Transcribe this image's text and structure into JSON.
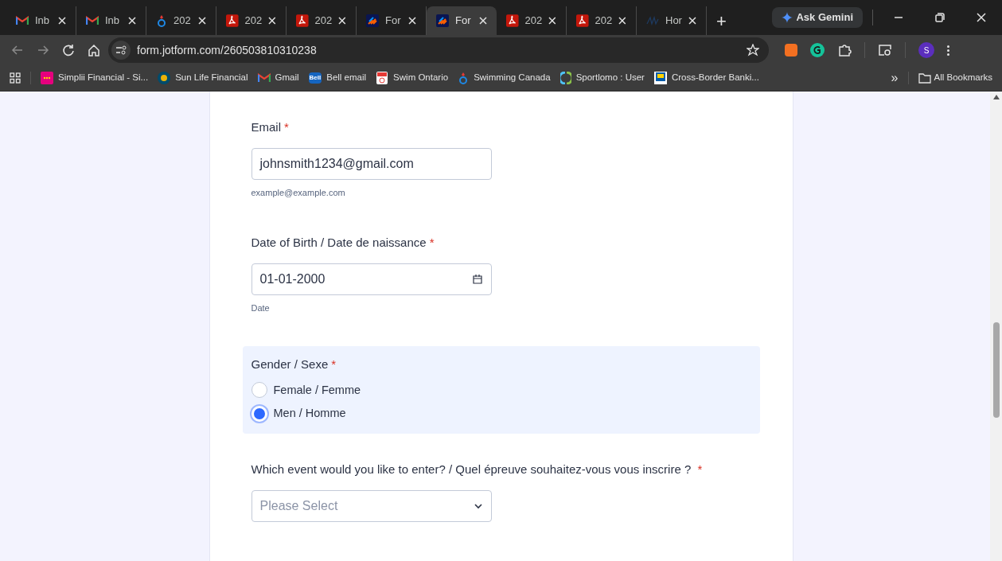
{
  "tabs": [
    {
      "kind": "gmail",
      "label": "Inb",
      "selected": false
    },
    {
      "kind": "gmail",
      "label": "Inb",
      "selected": false
    },
    {
      "kind": "swim",
      "label": "202",
      "selected": false
    },
    {
      "kind": "pdf",
      "label": "202",
      "selected": false
    },
    {
      "kind": "pdf",
      "label": "202",
      "selected": false
    },
    {
      "kind": "jotform",
      "label": "For",
      "selected": false
    },
    {
      "kind": "jotform",
      "label": "For",
      "selected": true
    },
    {
      "kind": "pdf",
      "label": "202",
      "selected": false
    },
    {
      "kind": "pdf",
      "label": "202",
      "selected": false
    },
    {
      "kind": "pen",
      "label": "Hor",
      "selected": false
    }
  ],
  "new_tab": "+",
  "gemini": "Ask Gemini",
  "address": "form.jotform.com/260503810310238",
  "profile": "S",
  "bookmarks": [
    {
      "kind": "simplii",
      "label": "Simplii Financial - Si..."
    },
    {
      "kind": "sunlife",
      "label": "Sun Life Financial"
    },
    {
      "kind": "gmail",
      "label": "Gmail"
    },
    {
      "kind": "bell",
      "label": "Bell email",
      "icon_text": "Bell"
    },
    {
      "kind": "swimon",
      "label": "Swim Ontario"
    },
    {
      "kind": "swim",
      "label": "Swimming Canada"
    },
    {
      "kind": "sportlomo",
      "label": "Sportlomo : User"
    },
    {
      "kind": "rbc",
      "label": "Cross-Border Banki..."
    }
  ],
  "overflow": "»",
  "all_bookmarks": "All Bookmarks",
  "form": {
    "email": {
      "label": "Email",
      "required_mark": "*",
      "value": "johnsmith1234@gmail.com",
      "hint": "example@example.com"
    },
    "dob": {
      "label": "Date of Birth / Date de naissance",
      "required_mark": "*",
      "value": "01-01-2000",
      "hint": "Date"
    },
    "gender": {
      "label": "Gender / Sexe",
      "required_mark": "*",
      "options": [
        {
          "label": "Female / Femme",
          "selected": false
        },
        {
          "label": "Men / Homme",
          "selected": true
        }
      ]
    },
    "event": {
      "label": "Which event would you like to enter? / Quel épreuve souhaitez-vous vous inscrire ?",
      "required_mark": "*",
      "placeholder": "Please Select"
    }
  }
}
